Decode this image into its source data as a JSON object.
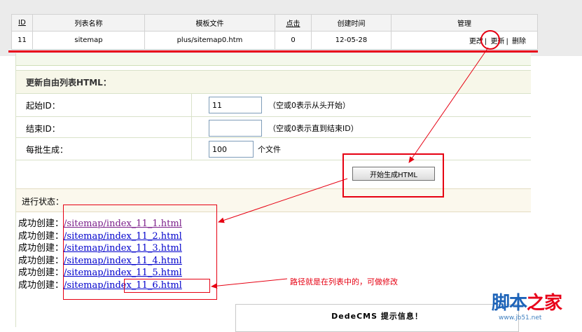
{
  "top_table": {
    "headers": [
      "ID",
      "列表名称",
      "模板文件",
      "点击",
      "创建时间",
      "管理"
    ],
    "row": {
      "id": "11",
      "name": "sitemap",
      "template": "plus/sitemap0.htm",
      "clicks": "0",
      "created": "12-05-28",
      "actions": [
        "更改",
        "更新",
        "删除"
      ]
    }
  },
  "form": {
    "title": "更新自由列表HTML：",
    "start_id_label": "起始ID：",
    "start_id_value": "11",
    "start_id_hint": "（空或0表示从头开始）",
    "end_id_label": "结束ID：",
    "end_id_value": "",
    "end_id_hint": "（空或0表示直到结束ID）",
    "batch_label": "每批生成：",
    "batch_value": "100",
    "batch_unit": "个文件",
    "start_button": "开始生成HTML",
    "status_label": "进行状态："
  },
  "results": [
    {
      "prefix": "成功创建：",
      "link": "/sitemap/index_11_1.html",
      "visited": true
    },
    {
      "prefix": "成功创建：",
      "link": "/sitemap/index_11_2.html",
      "visited": false
    },
    {
      "prefix": "成功创建：",
      "link": "/sitemap/index_11_3.html",
      "visited": false
    },
    {
      "prefix": "成功创建：",
      "link": "/sitemap/index_11_4.html",
      "visited": false
    },
    {
      "prefix": "成功创建：",
      "link": "/sitemap/index_11_5.html",
      "visited": false
    },
    {
      "prefix": "成功创建：",
      "link": "/sitemap/index_11_6.html",
      "visited": false
    }
  ],
  "annotation": "路径就是在列表中的，可做修改",
  "notice": "DedeCMS 提示信息！",
  "watermark": {
    "text_blue": "脚本",
    "text_red": "之家",
    "url": "www.jb51.net"
  },
  "colors": {
    "annotation_red": "#e60012",
    "link_blue": "#0000cc",
    "link_visited": "#7b1f8a"
  }
}
